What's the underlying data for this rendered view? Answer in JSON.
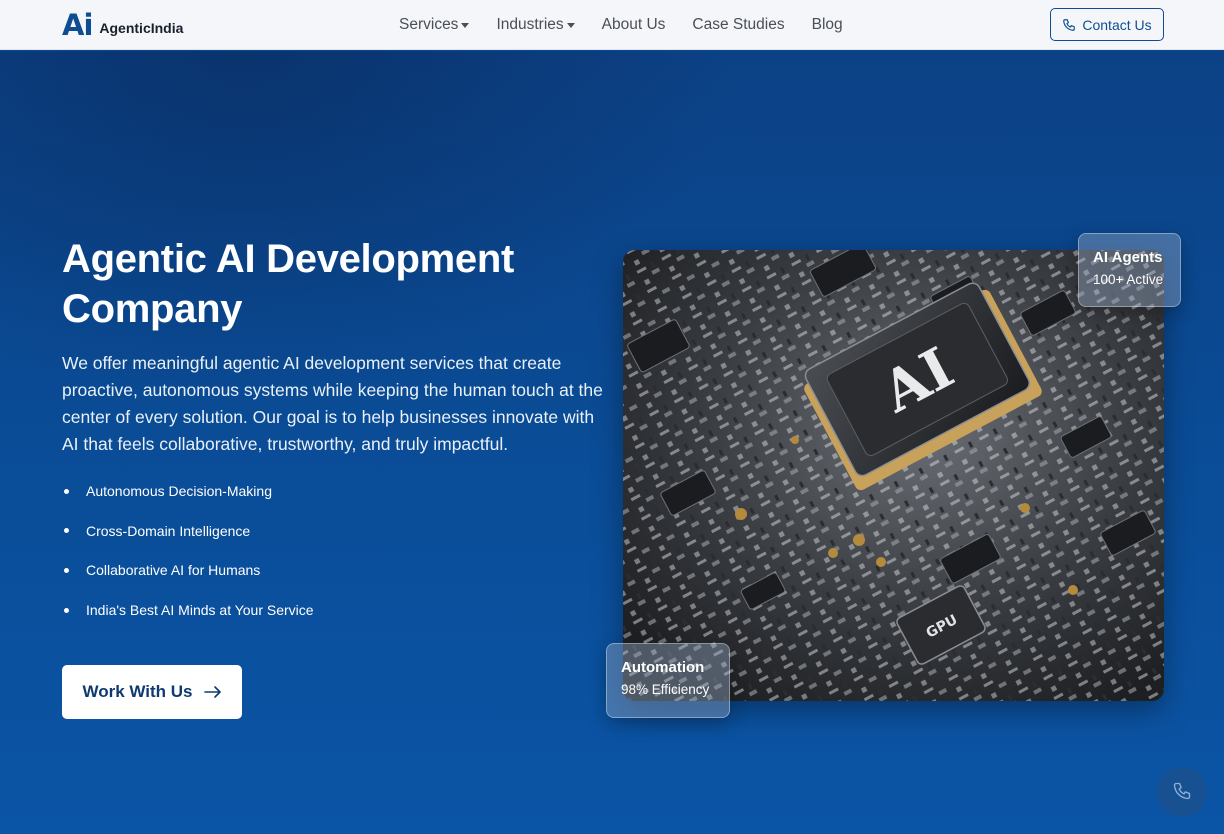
{
  "brand": {
    "logo_mark": "Ai",
    "name": "AgenticIndia"
  },
  "nav": {
    "links": [
      {
        "label": "Services",
        "dropdown": true
      },
      {
        "label": "Industries",
        "dropdown": true
      },
      {
        "label": "About Us",
        "dropdown": false
      },
      {
        "label": "Case Studies",
        "dropdown": false
      },
      {
        "label": "Blog",
        "dropdown": false
      }
    ],
    "contact_label": "Contact Us"
  },
  "hero": {
    "title": "Agentic AI Development Company",
    "description": "We offer meaningful agentic AI development services that create proactive, autonomous systems while keeping the human touch at the center of every solution. Our goal is to help businesses innovate with AI that feels collaborative, trustworthy, and truly impactful.",
    "features": [
      "Autonomous Decision-Making",
      "Cross-Domain Intelligence",
      "Collaborative AI for Humans",
      "India's Best AI Minds at Your Service"
    ],
    "cta_label": "Work With Us",
    "image": {
      "chip_label": "AI",
      "small_chip_label": "GPU"
    },
    "stats": [
      {
        "title": "AI Agents",
        "value": "100+ Active"
      },
      {
        "title": "Automation",
        "value": "98% Efficiency"
      }
    ]
  },
  "colors": {
    "brand_blue": "#0f4d93",
    "hero_bg": "#0a4d98",
    "nav_bg": "#f4f6f9"
  },
  "icons": [
    "phone-icon",
    "arrow-right-icon",
    "chevron-down-icon"
  ]
}
